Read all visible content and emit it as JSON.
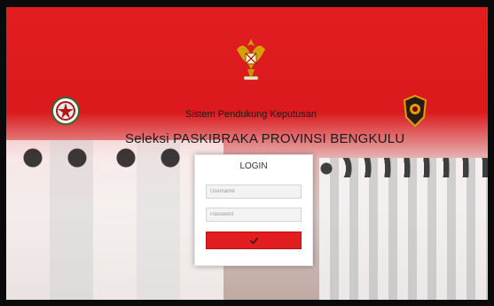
{
  "header": {
    "subtitle": "Sistem Pendukung Keputusan",
    "title": "Seleksi PASKIBRAKA PROVINSI BENGKULU"
  },
  "login": {
    "heading": "LOGIN",
    "username_placeholder": "Username",
    "password_placeholder": "Password",
    "submit_icon": "check-icon"
  },
  "icons": [
    "garuda-emblem-icon",
    "left-seal-icon",
    "right-badge-icon",
    "check-icon"
  ],
  "colors": {
    "brand_red": "#e11d1f",
    "panel_white": "#ffffff"
  }
}
